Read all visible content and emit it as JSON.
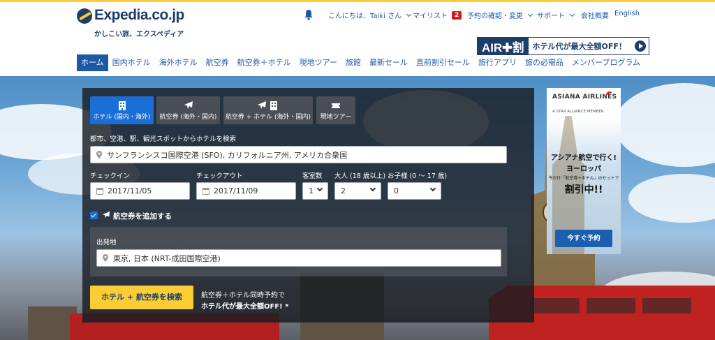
{
  "brand": {
    "name": "Expedia.co.jp",
    "tagline": "かしこい旅、エクスペディア"
  },
  "header": {
    "greeting": "こんにちは、Taiki さん",
    "mylist_label": "マイリスト",
    "mylist_count": "2",
    "reservations_label": "予約の確認・変更",
    "support_label": "サポート",
    "company_label": "会社概要",
    "language_label": "English"
  },
  "promo": {
    "air_label": "AIR✚割",
    "text": "ホテル代が最大全額OFF！"
  },
  "nav": {
    "items": [
      {
        "label": "ホーム"
      },
      {
        "label": "国内ホテル"
      },
      {
        "label": "海外ホテル"
      },
      {
        "label": "航空券"
      },
      {
        "label": "航空券＋ホテル"
      },
      {
        "label": "現地ツアー"
      },
      {
        "label": "旅館"
      },
      {
        "label": "最新セール"
      },
      {
        "label": "直前割引セール"
      },
      {
        "label": "旅行アプリ"
      },
      {
        "label": "旅の必需品"
      },
      {
        "label": "メンバープログラム"
      }
    ]
  },
  "search": {
    "tabs": [
      {
        "label": "ホテル (国内・海外)"
      },
      {
        "label": "航空券 (海外・国内)"
      },
      {
        "label": "航空券 + ホテル (海外・国内)"
      },
      {
        "label": "現地ツアー"
      }
    ],
    "destination_label": "都市、空港、駅、観光スポットからホテルを検索",
    "destination_value": "サンフランシスコ国際空港 (SFO), カリフォルニア州, アメリカ合衆国",
    "checkin_label": "チェックイン",
    "checkin_value": "2017/11/05",
    "checkout_label": "チェックアウト",
    "checkout_value": "2017/11/09",
    "rooms_label": "客室数",
    "rooms_value": "1",
    "adults_label": "大人 (18 歳以上)",
    "adults_value": "2",
    "children_label": "お子様 (0 〜 17 歳)",
    "children_value": "0",
    "add_flight_label": "航空券を追加する",
    "origin_label": "出発地",
    "origin_value": "東京, 日本 (NRT-成田国際空港)",
    "submit_label": "ホテル + 航空券を検索",
    "note_line1": "航空券＋ホテル同時予約で",
    "note_line2": "ホテル代が最大全額OFF! *"
  },
  "ad": {
    "airline": "ASIANA AIRLINES",
    "alliance": "A STAR ALLIANCE MEMBER",
    "line1": "アシアナ航空で行く!",
    "line2": "ヨーロッパ",
    "line3": "今だけ「航空券+ホテル」のセットで",
    "line4": "割引中!!",
    "cta": "今すぐ予約"
  },
  "colors": {
    "brand_navy": "#1e3d6b",
    "link_blue": "#1b58a5",
    "active_tab": "#1b6ed4",
    "cta_yellow": "#fbcc33",
    "badge_red": "#d01c1c"
  }
}
